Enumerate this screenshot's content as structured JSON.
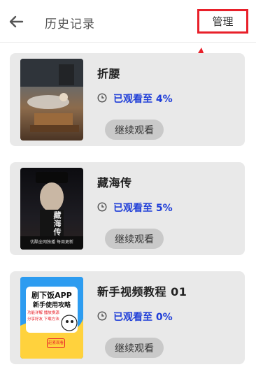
{
  "header": {
    "back_icon": "arrow-left-icon",
    "title": "历史记录",
    "manage_label": "管理"
  },
  "colors": {
    "progress_text": "#1f3ed8",
    "highlight_box": "#e8202a",
    "card_bg": "#e9e9e9",
    "button_bg": "#c9c9c9"
  },
  "history": [
    {
      "title": "折腰",
      "progress_text": "已观看至 4%",
      "continue_label": "继续观看",
      "poster_text": "",
      "icon": "clock-icon"
    },
    {
      "title": "藏海传",
      "progress_text": "已观看至 5%",
      "continue_label": "继续观看",
      "poster_text": "藏海传",
      "poster_caption": "优酷全网独播 每周更新",
      "icon": "clock-icon"
    },
    {
      "title": "新手视频教程 01",
      "progress_text": "已观看至 0%",
      "continue_label": "继续观看",
      "poster_title": "剧下饭APP",
      "poster_subtitle": "新手使用攻略",
      "poster_tags": [
        "功能详解",
        "播放换源",
        "分享好友",
        "下载方法"
      ],
      "poster_badge": "赶紧观看",
      "icon": "clock-icon"
    }
  ]
}
